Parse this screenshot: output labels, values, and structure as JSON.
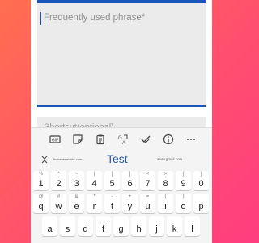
{
  "form": {
    "phrase_placeholder": "Frequently used phrase*",
    "shortcut_placeholder": "Shortcut(optional)"
  },
  "keyboard": {
    "toolbar_icons": [
      "gif-icon",
      "sticker-icon",
      "clipboard-icon",
      "translate-icon",
      "checkmark-icon",
      "info-icon",
      "more-icon"
    ],
    "suggestions": {
      "left": "thebestwebsite.com",
      "center": "Test",
      "right": "www.gmail.com"
    },
    "number_row": [
      {
        "sub": "%",
        "main": "1"
      },
      {
        "sub": "^",
        "main": "2"
      },
      {
        "sub": "~",
        "main": "3"
      },
      {
        "sub": "|",
        "main": "4"
      },
      {
        "sub": "[",
        "main": "5"
      },
      {
        "sub": "]",
        "main": "6"
      },
      {
        "sub": "<",
        "main": "7"
      },
      {
        "sub": ">",
        "main": "8"
      },
      {
        "sub": "{",
        "main": "9"
      },
      {
        "sub": "}",
        "main": "0"
      }
    ],
    "top_row": [
      {
        "sub": "@",
        "main": "q"
      },
      {
        "sub": "#",
        "main": "w"
      },
      {
        "sub": "&",
        "main": "e"
      },
      {
        "sub": "*",
        "main": "r"
      },
      {
        "sub": "-",
        "main": "t"
      },
      {
        "sub": "+",
        "main": "y"
      },
      {
        "sub": "=",
        "main": "u"
      },
      {
        "sub": "(",
        "main": "i"
      },
      {
        "sub": ")",
        "main": "o"
      },
      {
        "sub": "",
        "main": "p"
      }
    ],
    "home_row": [
      {
        "sub": "",
        "main": "a"
      },
      {
        "sub": "",
        "main": "s"
      },
      {
        "sub": "",
        "main": "d"
      },
      {
        "sub": "",
        "main": "f"
      },
      {
        "sub": "",
        "main": "g"
      },
      {
        "sub": "",
        "main": "h"
      },
      {
        "sub": "",
        "main": "j"
      },
      {
        "sub": "",
        "main": "k"
      },
      {
        "sub": "",
        "main": "l"
      }
    ]
  },
  "colors": {
    "accent": "#1a56b8",
    "suggestion": "#2a5aa0"
  }
}
